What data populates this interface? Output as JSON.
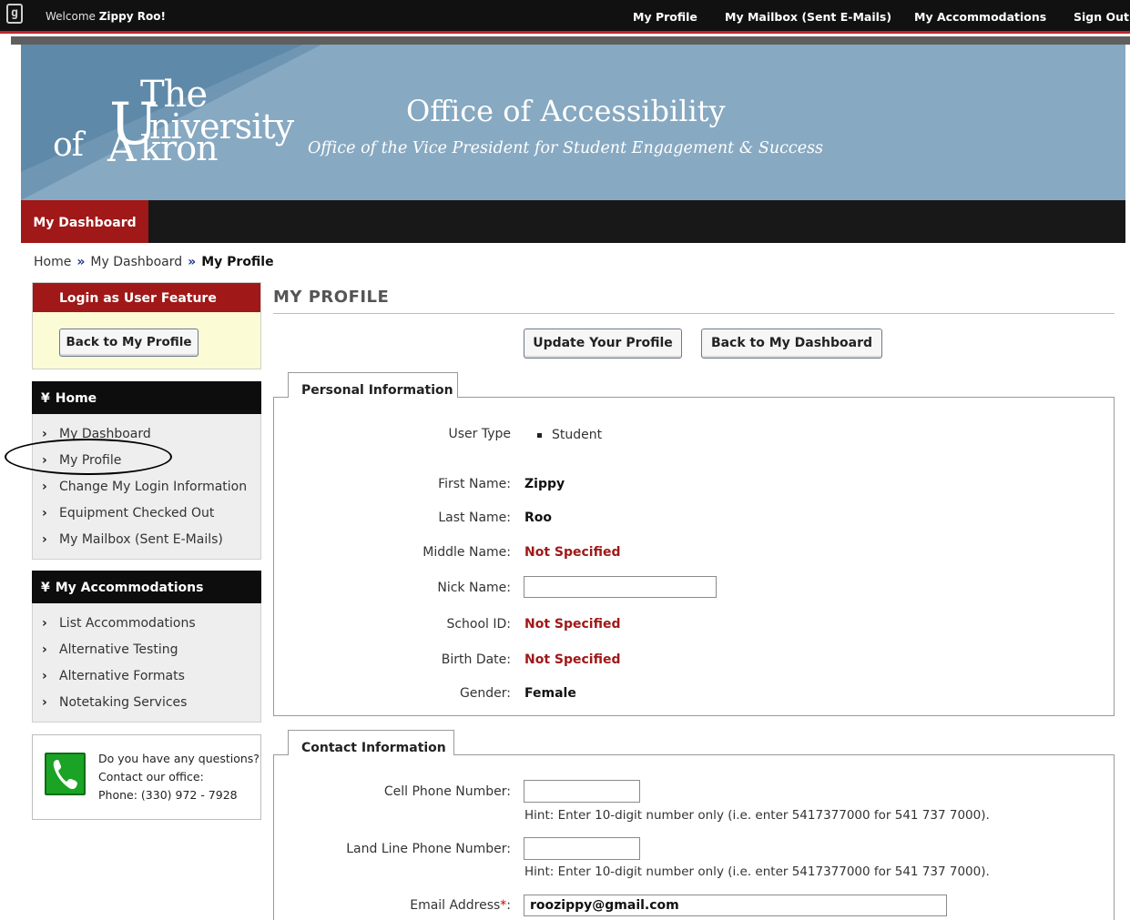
{
  "topbar": {
    "welcome_prefix": "Welcome",
    "user_name": "Zippy Roo!",
    "links": [
      "My Profile",
      "My Mailbox (Sent E-Mails)",
      "My Accommodations",
      "Sign Out"
    ]
  },
  "banner": {
    "logo": {
      "the": "The",
      "of": "of",
      "u": "U",
      "niversity": "niversity",
      "a": "A",
      "kron": "kron"
    },
    "title": "Office of Accessibility",
    "subtitle": "Office of the Vice President for Student Engagement & Success"
  },
  "nav": {
    "dashboard": "My Dashboard"
  },
  "breadcrumb": {
    "home": "Home",
    "sep": "»",
    "dashboard": "My Dashboard",
    "current": "My Profile"
  },
  "login_box": {
    "title": "Login as User Feature",
    "button": "Back to My Profile"
  },
  "home_menu": {
    "title": "Home",
    "items": [
      "My Dashboard",
      "My Profile",
      "Change My Login Information",
      "Equipment Checked Out",
      "My Mailbox (Sent E-Mails)"
    ]
  },
  "acc_menu": {
    "title": "My Accommodations",
    "items": [
      "List Accommodations",
      "Alternative Testing",
      "Alternative Formats",
      "Notetaking Services"
    ]
  },
  "contact_box": {
    "line1": "Do you have any questions?",
    "line2": "Contact our office:",
    "line3": "Phone: (330) 972 - 7928"
  },
  "main": {
    "title": "MY PROFILE",
    "update_button": "Update Your Profile",
    "back_button": "Back to My Dashboard"
  },
  "personal": {
    "title": "Personal Information",
    "user_type_label": "User Type",
    "user_type_value": "Student",
    "first_name_label": "First Name:",
    "first_name": "Zippy",
    "last_name_label": "Last Name:",
    "last_name": "Roo",
    "middle_name_label": "Middle Name:",
    "middle_name": "Not Specified",
    "nick_name_label": "Nick Name:",
    "nick_name": "",
    "school_id_label": "School ID:",
    "school_id": "Not Specified",
    "birth_date_label": "Birth Date:",
    "birth_date": "Not Specified",
    "gender_label": "Gender:",
    "gender": "Female"
  },
  "contact": {
    "title": "Contact Information",
    "cell_label": "Cell Phone Number:",
    "cell_value": "",
    "cell_hint": "Hint: Enter 10-digit number only (i.e. enter 5417377000 for 541 737 7000).",
    "land_label": "Land Line Phone Number:",
    "land_value": "",
    "land_hint": "Hint: Enter 10-digit number only (i.e. enter 5417377000 for 541 737 7000).",
    "email_label": "Email Address",
    "email_req": "*",
    "email_colon": ":",
    "email_value": "roozippy@gmail.com"
  }
}
